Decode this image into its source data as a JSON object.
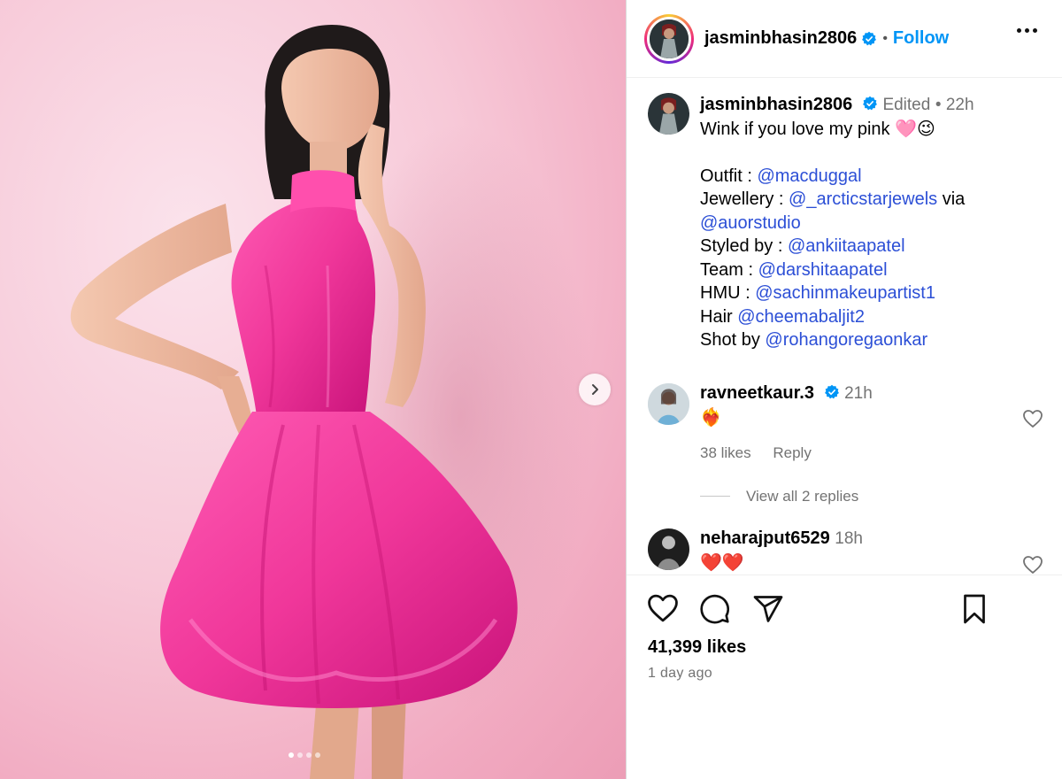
{
  "post": {
    "username": "jasminbhasin2806",
    "follow_label": "Follow",
    "carousel_dots": 4,
    "active_dot": 0
  },
  "caption": {
    "username": "jasminbhasin2806",
    "edited": "Edited",
    "time": "22h",
    "text": "Wink if you love my pink 🩷😉",
    "lines": [
      {
        "prefix": "Outfit : ",
        "mention": "@macduggal",
        "suffix": ""
      },
      {
        "prefix": "Jewellery : ",
        "mention": "@_arcticstarjewels",
        "suffix": " via"
      },
      {
        "prefix": "",
        "mention": "@auorstudio",
        "suffix": ""
      },
      {
        "prefix": "Styled by : ",
        "mention": "@ankiitaapatel",
        "suffix": ""
      },
      {
        "prefix": "Team : ",
        "mention": "@darshitaapatel",
        "suffix": ""
      },
      {
        "prefix": "HMU : ",
        "mention": "@sachinmakeupartist1",
        "suffix": ""
      },
      {
        "prefix": "Hair ",
        "mention": "@cheemabaljit2",
        "suffix": ""
      },
      {
        "prefix": "Shot by ",
        "mention": "@rohangoregaonkar",
        "suffix": ""
      }
    ]
  },
  "comments": [
    {
      "username": "ravneetkaur.3",
      "verified": true,
      "time": "21h",
      "text": "❤️‍🔥",
      "likes": "38 likes",
      "reply_label": "Reply",
      "view_replies": "View all 2 replies"
    },
    {
      "username": "neharajput6529",
      "verified": false,
      "time": "18h",
      "text": "❤️❤️"
    }
  ],
  "footer": {
    "likes": "41,399 likes",
    "time_ago": "1 day ago"
  },
  "colors": {
    "follow": "#0095f6",
    "mention": "#2c4fd6",
    "verified": "#0095f6",
    "dress": "#f0379a"
  }
}
